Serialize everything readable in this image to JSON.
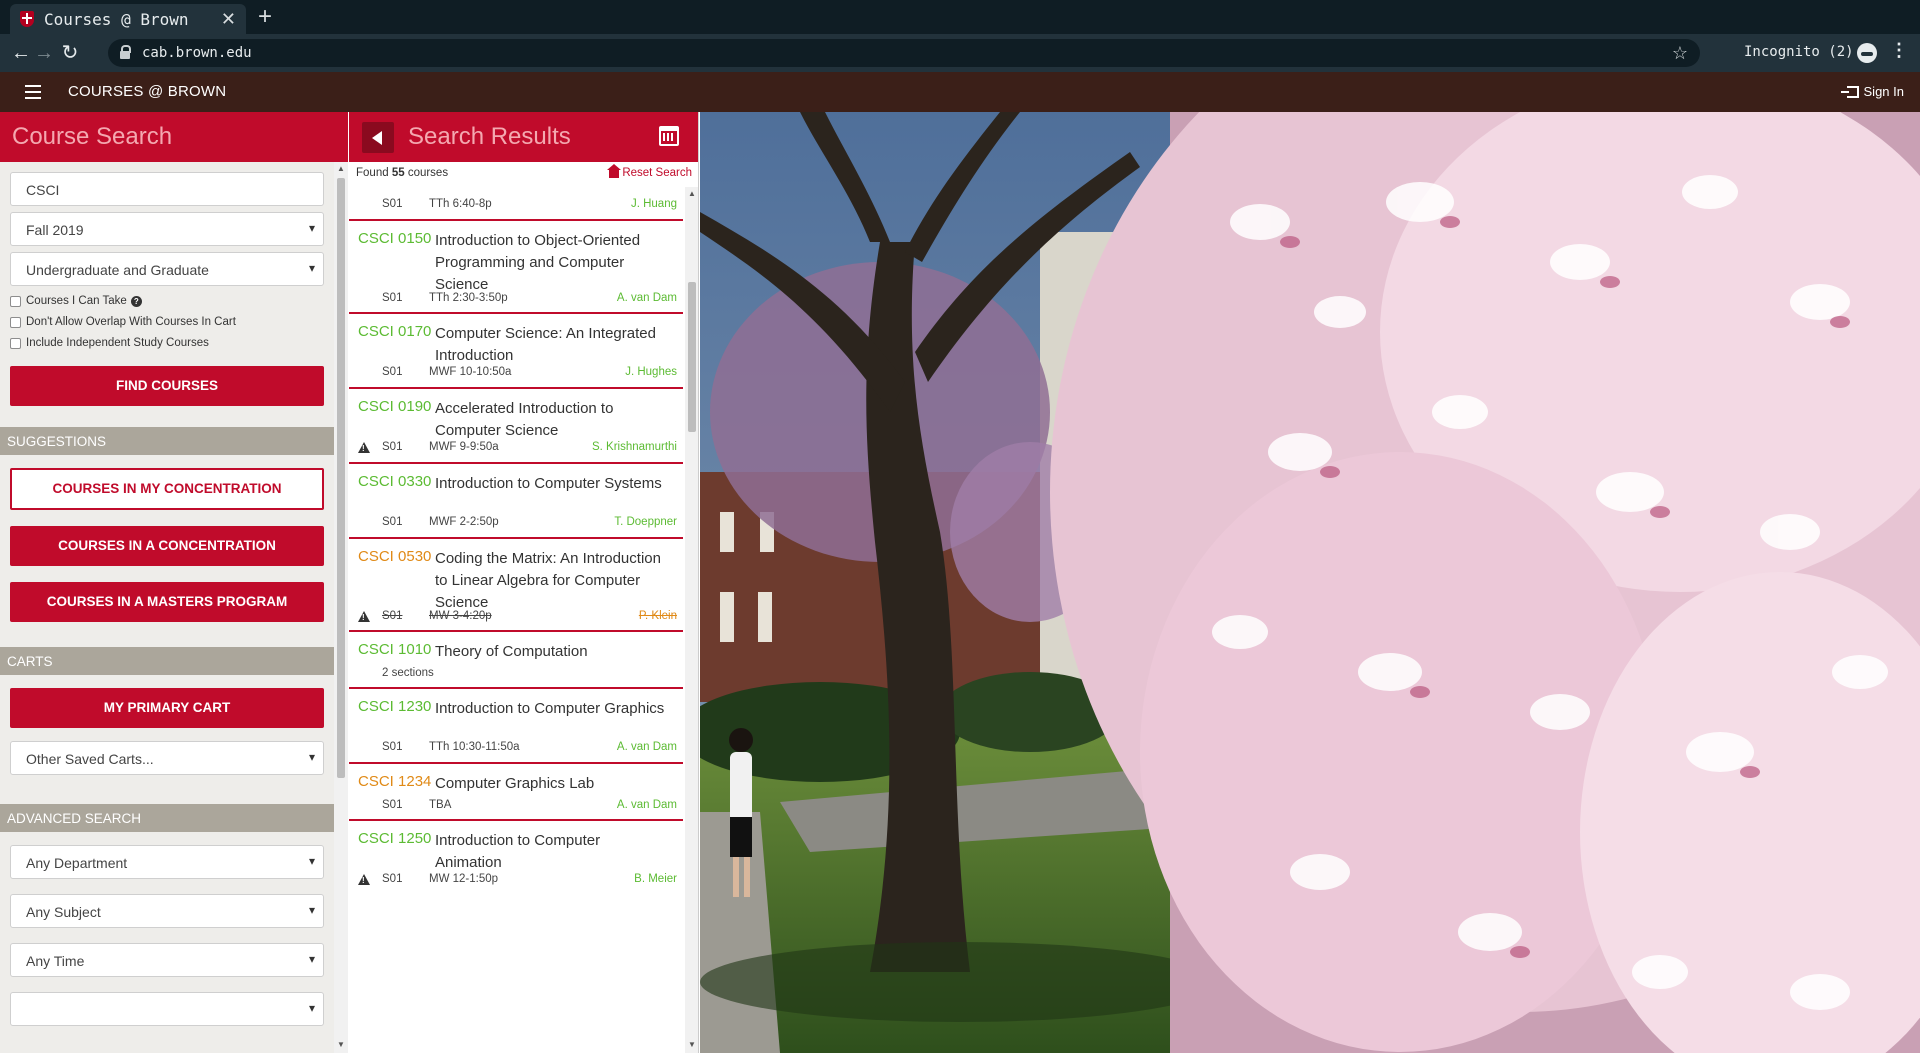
{
  "browser": {
    "tab_title": "Courses @ Brown",
    "url": "cab.brown.edu",
    "incognito": "Incognito (2)"
  },
  "header": {
    "brand": "COURSES @ BROWN",
    "signin": "Sign In"
  },
  "search": {
    "title": "Course Search",
    "keyword": "CSCI",
    "term": "Fall 2019",
    "level": "Undergraduate and Graduate",
    "checks": [
      "Courses I Can Take",
      "Don't Allow Overlap With Courses In Cart",
      "Include Independent Study Courses"
    ],
    "find_button": "FIND COURSES"
  },
  "suggestions": {
    "label": "SUGGESTIONS",
    "my_concentration": "COURSES IN MY CONCENTRATION",
    "a_concentration": "COURSES IN A CONCENTRATION",
    "masters": "COURSES IN A MASTERS PROGRAM"
  },
  "carts": {
    "label": "CARTS",
    "primary": "MY PRIMARY CART",
    "other": "Other Saved Carts..."
  },
  "advanced": {
    "label": "ADVANCED SEARCH",
    "department": "Any Department",
    "subject": "Any Subject",
    "time": "Any Time"
  },
  "results": {
    "title": "Search Results",
    "found_prefix": "Found",
    "found_count": "55",
    "found_suffix": "courses",
    "reset": "Reset Search",
    "partial_section": {
      "sid": "S01",
      "time": "TTh 6:40-8p",
      "inst": "J. Huang"
    },
    "courses": [
      {
        "code": "CSCI 0150",
        "title": "Introduction to Object-Oriented Programming and Computer Science",
        "sid": "S01",
        "time": "TTh 2:30-3:50p",
        "inst": "A. van Dam"
      },
      {
        "code": "CSCI 0170",
        "title": "Computer Science: An Integrated Introduction",
        "sid": "S01",
        "time": "MWF 10-10:50a",
        "inst": "J. Hughes"
      },
      {
        "code": "CSCI 0190",
        "title": "Accelerated Introduction to Computer Science",
        "sid": "S01",
        "time": "MWF 9-9:50a",
        "inst": "S. Krishnamurthi"
      },
      {
        "code": "CSCI 0330",
        "title": "Introduction to Computer Systems",
        "sid": "S01",
        "time": "MWF 2-2:50p",
        "inst": "T. Doeppner"
      },
      {
        "code": "CSCI 0530",
        "title": "Coding the Matrix: An Introduction to Linear Algebra for Computer Science",
        "sid": "S01",
        "time": "MW 3-4:20p",
        "inst": "P. Klein"
      },
      {
        "code": "CSCI 1010",
        "title": "Theory of Computation",
        "sections": "2 sections"
      },
      {
        "code": "CSCI 1230",
        "title": "Introduction to Computer Graphics",
        "sid": "S01",
        "time": "TTh 10:30-11:50a",
        "inst": "A. van Dam"
      },
      {
        "code": "CSCI 1234",
        "title": "Computer Graphics Lab",
        "sid": "S01",
        "time": "TBA",
        "inst": "A. van Dam"
      },
      {
        "code": "CSCI 1250",
        "title": "Introduction to Computer Animation",
        "sid": "S01",
        "time": "MW 12-1:50p",
        "inst": "B. Meier"
      }
    ]
  }
}
